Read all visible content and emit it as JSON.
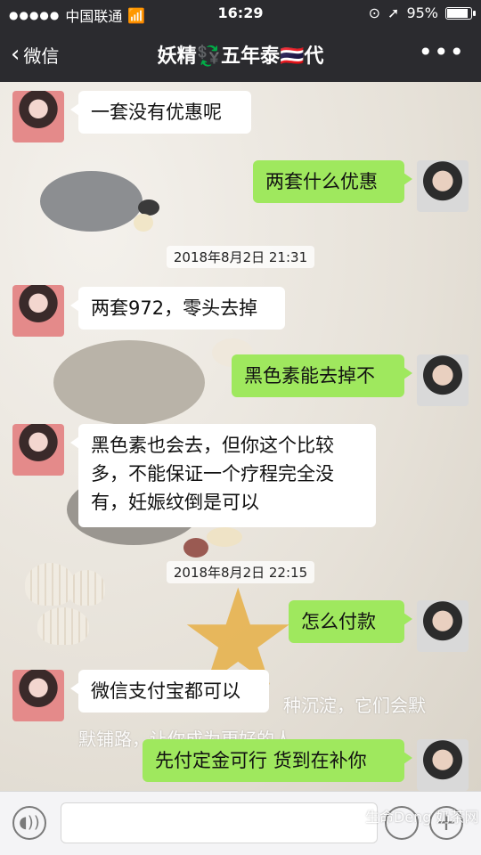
{
  "status_bar": {
    "carrier": "中国联通",
    "time": "16:29",
    "battery": "95%",
    "battery_fraction": 0.95
  },
  "nav": {
    "back_label": "微信",
    "title": "妖精💱五年泰🇹🇭代",
    "more_icon": "more-dots-icon"
  },
  "messages": [
    {
      "side": "in",
      "text": "一套没有优惠呢"
    },
    {
      "side": "out",
      "text": "两套什么优惠"
    },
    {
      "side": "time",
      "text": "2018年8月2日 21:31"
    },
    {
      "side": "in",
      "text": "两套972，零头去掉"
    },
    {
      "side": "out",
      "text": "黑色素能去掉不"
    },
    {
      "side": "in",
      "text": "黑色素也会去，但你这个比较多，不能保证一个疗程完全没有，妊娠纹倒是可以"
    },
    {
      "side": "time",
      "text": "2018年8月2日 22:15"
    },
    {
      "side": "out",
      "text": "怎么付款"
    },
    {
      "side": "in",
      "text": "微信支付宝都可以"
    },
    {
      "side": "out",
      "text": "先付定金可行 货到在补你"
    }
  ],
  "background_text": {
    "line1": "种沉淀，它们会默",
    "line2": "默铺路，让你成为更好的人。"
  },
  "watermark": "生命Deng 奶茶网",
  "input_bar": {
    "voice_icon": "voice-icon",
    "emoji_icon": "emoji-icon",
    "plus_icon": "plus-icon"
  }
}
